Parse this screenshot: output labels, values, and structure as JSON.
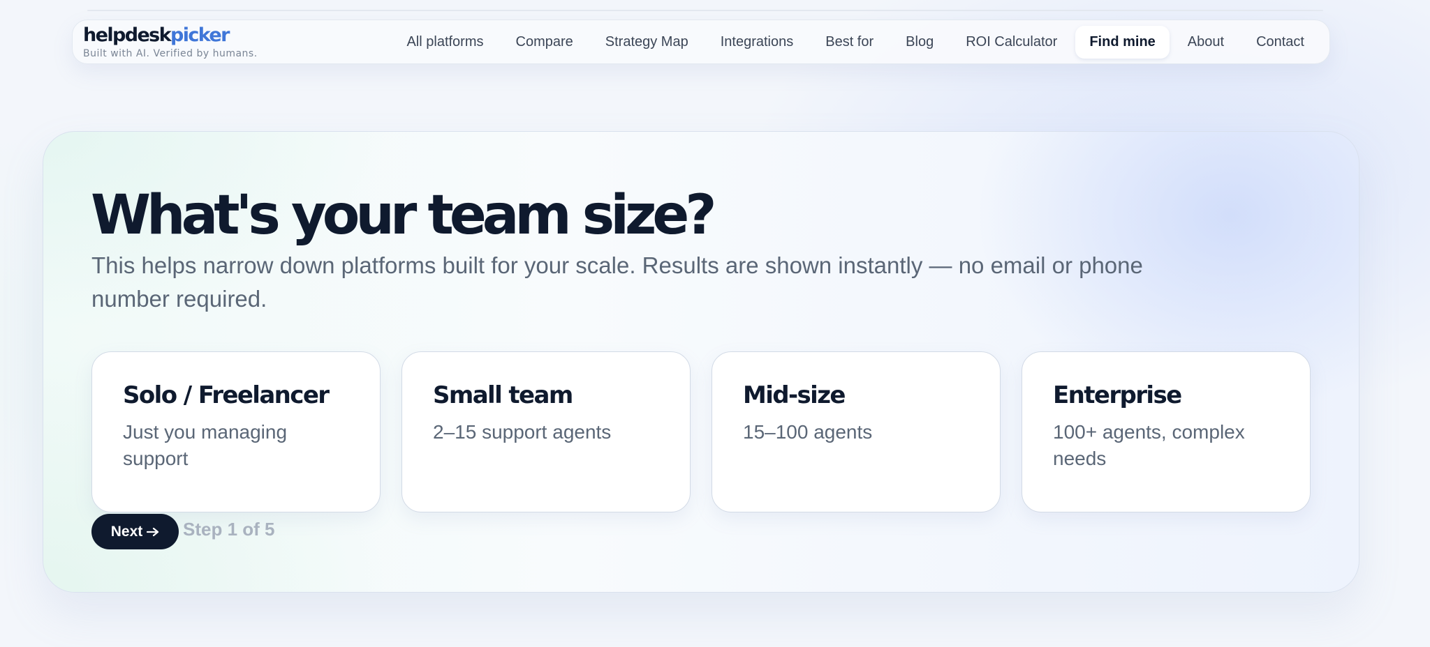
{
  "brand": {
    "name_part1": "helpdesk",
    "name_part2": "picker",
    "tagline": "Built with AI. Verified by humans.",
    "accent_color": "#3f76d8"
  },
  "nav": {
    "items": [
      {
        "label": "All platforms"
      },
      {
        "label": "Compare"
      },
      {
        "label": "Strategy Map"
      },
      {
        "label": "Integrations"
      },
      {
        "label": "Best for"
      },
      {
        "label": "Blog"
      },
      {
        "label": "ROI Calculator"
      },
      {
        "label": "Find mine",
        "active": true
      },
      {
        "label": "About"
      },
      {
        "label": "Contact"
      }
    ]
  },
  "quiz": {
    "title": "What's your team size?",
    "description": "This helps narrow down platforms built for your scale. Results are shown instantly — no email or phone number required.",
    "options": [
      {
        "title": "Solo / Freelancer",
        "subtitle": "Just you managing support"
      },
      {
        "title": "Small team",
        "subtitle": "2–15 support agents"
      },
      {
        "title": "Mid-size",
        "subtitle": "15–100 agents"
      },
      {
        "title": "Enterprise",
        "subtitle": "100+ agents, complex needs"
      }
    ],
    "next_label": "Next",
    "next_icon": "arrow-right-icon",
    "step_text": "Step 1 of 5"
  }
}
